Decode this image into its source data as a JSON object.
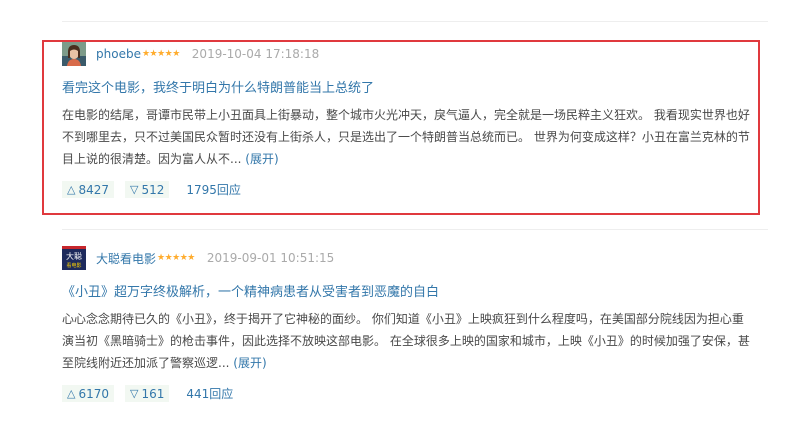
{
  "reviews": [
    {
      "username": "phoebe",
      "stars": "★★★★★",
      "time": "2019-10-04 17:18:18",
      "title": "看完这个电影，我终于明白为什么特朗普能当上总统了",
      "body": "在电影的结尾，哥谭市民带上小丑面具上街暴动，整个城市火光冲天，戾气逼人，完全就是一场民粹主义狂欢。 我看现实世界也好不到哪里去，只不过美国民众暂时还没有上街杀人，只是选出了一个特朗普当总统而已。 世界为何变成这样？小丑在富兰克林的节目上说的很清楚。因为富人从不...",
      "expand": "(展开)",
      "up": "8427",
      "down": "512",
      "replies": "1795回应",
      "avatar_icon": "woman-portrait-avatar"
    },
    {
      "username": "大聪看电影",
      "stars": "★★★★★",
      "time": "2019-09-01 10:51:15",
      "title": "《小丑》超万字终极解析，一个精神病患者从受害者到恶魔的自白",
      "body": "心心念念期待已久的《小丑》，终于揭开了它神秘的面纱。 你们知道《小丑》上映疯狂到什么程度吗，在美国部分院线因为担心重演当初《黑暗骑士》的枪击事件，因此选择不放映这部电影。 在全球很多上映的国家和城市，上映《小丑》的时候加强了安保，甚至院线附近还加派了警察巡逻...",
      "expand": "(展开)",
      "up": "6170",
      "down": "161",
      "replies": "441回应",
      "avatar_icon": "dacong-logo-avatar",
      "avatar_text": "大聪看电影"
    }
  ],
  "icons": {
    "upvote": "up-triangle-icon",
    "downvote": "down-triangle-icon"
  },
  "colors": {
    "link": "#3377aa",
    "star": "#ffac2d",
    "highlight": "#e0393e",
    "vote_bg": "#f2f8f2"
  }
}
